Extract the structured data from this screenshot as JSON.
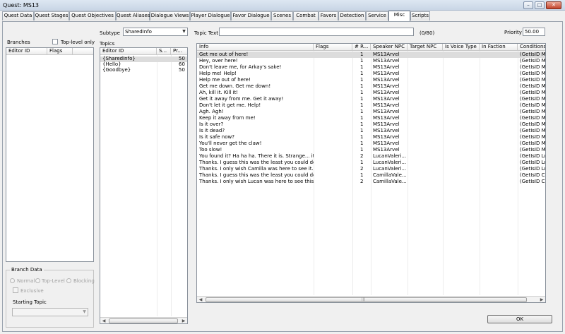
{
  "window": {
    "title": "Quest: MS13",
    "minimize": "–",
    "maximize": "□",
    "close": "✕"
  },
  "tabs": [
    "Quest Data",
    "Quest Stages",
    "Quest Objectives",
    "Quest Aliases",
    "Dialogue Views",
    "Player Dialogue",
    "Favor Dialogue",
    "Scenes",
    "Combat",
    "Favors",
    "Detection",
    "Service",
    "Misc",
    "Scripts"
  ],
  "branches": {
    "label": "Branches",
    "toplevel_only": "Top-level only",
    "columns": [
      "Editor ID",
      "Flags"
    ]
  },
  "branch_data": {
    "label": "Branch Data",
    "radios": [
      "Normal",
      "Top-Level",
      "Blocking"
    ],
    "exclusive": "Exclusive",
    "starting_topic": "Starting Topic"
  },
  "subtype": {
    "label": "Subtype",
    "value": "SharedInfo"
  },
  "topic_text": {
    "label": "Topic Text",
    "value": "",
    "counter": "(0/80)"
  },
  "priority": {
    "label": "Priority",
    "value": "50.00"
  },
  "topics": {
    "label": "Topics",
    "columns": [
      "Editor ID",
      "S...",
      "Pr..."
    ],
    "rows": [
      {
        "id": "{SharedInfo}",
        "s": "",
        "pr": "50"
      },
      {
        "id": "{Hello}",
        "s": "",
        "pr": "60"
      },
      {
        "id": "{Goodbye}",
        "s": "",
        "pr": "50"
      }
    ]
  },
  "info": {
    "columns": [
      "Info",
      "Flags",
      "# R...",
      "Speaker NPC",
      "Target NPC",
      "Is Voice Type",
      "In Faction",
      "Conditions"
    ],
    "rows": [
      {
        "info": "Get me out of here!",
        "r": "1",
        "speaker": "MS13Arvel",
        "cond": "(GetIsID M..."
      },
      {
        "info": "Hey, over here!",
        "r": "1",
        "speaker": "MS13Arvel",
        "cond": "(GetIsID M..."
      },
      {
        "info": "Don't leave me, for Arkay's sake!",
        "r": "1",
        "speaker": "MS13Arvel",
        "cond": "(GetIsID M..."
      },
      {
        "info": "Help me! Help!",
        "r": "1",
        "speaker": "MS13Arvel",
        "cond": "(GetIsID M..."
      },
      {
        "info": "Help me out of here!",
        "r": "1",
        "speaker": "MS13Arvel",
        "cond": "(GetIsID M..."
      },
      {
        "info": "Get me down. Get me down!",
        "r": "1",
        "speaker": "MS13Arvel",
        "cond": "(GetIsID M..."
      },
      {
        "info": "Ah, kill it. Kill it!",
        "r": "1",
        "speaker": "MS13Arvel",
        "cond": "(GetIsID M..."
      },
      {
        "info": "Get it away from me. Get it away!",
        "r": "1",
        "speaker": "MS13Arvel",
        "cond": "(GetIsID M..."
      },
      {
        "info": "Don't let it get me. Help!",
        "r": "1",
        "speaker": "MS13Arvel",
        "cond": "(GetIsID M..."
      },
      {
        "info": "Agh. Agh!",
        "r": "1",
        "speaker": "MS13Arvel",
        "cond": "(GetIsID M..."
      },
      {
        "info": "Keep it away from me!",
        "r": "1",
        "speaker": "MS13Arvel",
        "cond": "(GetIsID M..."
      },
      {
        "info": "Is it over?",
        "r": "1",
        "speaker": "MS13Arvel",
        "cond": "(GetIsID M..."
      },
      {
        "info": "Is it dead?",
        "r": "1",
        "speaker": "MS13Arvel",
        "cond": "(GetIsID M..."
      },
      {
        "info": "Is it safe now?",
        "r": "1",
        "speaker": "MS13Arvel",
        "cond": "(GetIsID M..."
      },
      {
        "info": "You'll never get the claw!",
        "r": "1",
        "speaker": "MS13Arvel",
        "cond": "(GetIsID M..."
      },
      {
        "info": "Too slow!",
        "r": "1",
        "speaker": "MS13Arvel",
        "cond": "(GetIsID M..."
      },
      {
        "info": "You found it? Ha ha ha. There it is. Strange... it s...",
        "r": "2",
        "speaker": "LucanValeri...",
        "cond": "(GetIsID Lu..."
      },
      {
        "info": "Thanks. I guess this was the least you could do a...",
        "r": "1",
        "speaker": "LucanValeri...",
        "cond": "(GetIsID Lu..."
      },
      {
        "info": "Thanks. I only wish Camilla was here to see it. | H...",
        "r": "2",
        "speaker": "LucanValeri...",
        "cond": "(GetIsID Lu..."
      },
      {
        "info": "Thanks. I guess this was the least you could do a...",
        "r": "1",
        "speaker": "CamillaVale...",
        "cond": "(GetIsID Ca..."
      },
      {
        "info": "Thanks. I only wish Lucan was here to see this a...",
        "r": "2",
        "speaker": "CamillaVale...",
        "cond": "(GetIsID Ca..."
      }
    ]
  },
  "ok_button": "OK",
  "scroll": {
    "left": "◀",
    "right": "▶",
    "grip": "|||",
    "down": "▼"
  }
}
